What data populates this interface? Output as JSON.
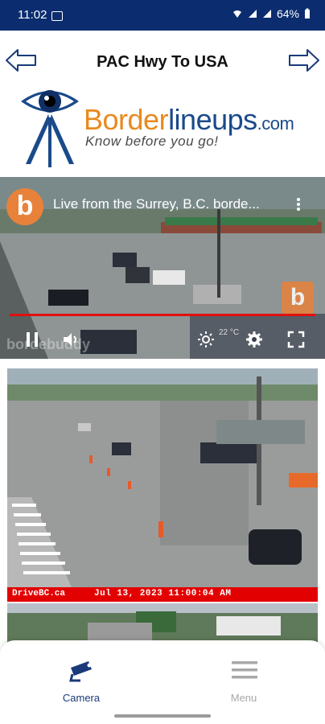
{
  "status_bar": {
    "time": "11:02",
    "battery": "64%"
  },
  "header": {
    "title": "PAC Hwy To USA",
    "back_icon": "arrow-left-icon",
    "forward_icon": "arrow-right-icon"
  },
  "logo": {
    "brand_part1": "Border",
    "brand_part2": "lineups",
    "brand_part3": ".com",
    "tagline": "Know before you go!"
  },
  "video": {
    "channel_initial": "b",
    "title": "Live from the Surrey, B.C. borde...",
    "watermark": "bordebuddy",
    "temperature": "22 °C"
  },
  "camera_feed": {
    "source": "DriveBC.ca",
    "timestamp": "Jul 13, 2023 11:00:04 AM"
  },
  "bottom_nav": {
    "items": [
      {
        "label": "Camera",
        "icon": "camera-icon",
        "active": true
      },
      {
        "label": "Menu",
        "icon": "menu-icon",
        "active": false
      }
    ]
  },
  "colors": {
    "status_bar": "#0b2d6f",
    "brand_orange": "#e88a1e",
    "brand_blue": "#1a4a8a",
    "timestamp_band": "#e30000",
    "nav_active": "#1a3a7a",
    "nav_inactive": "#a8a8a8"
  }
}
